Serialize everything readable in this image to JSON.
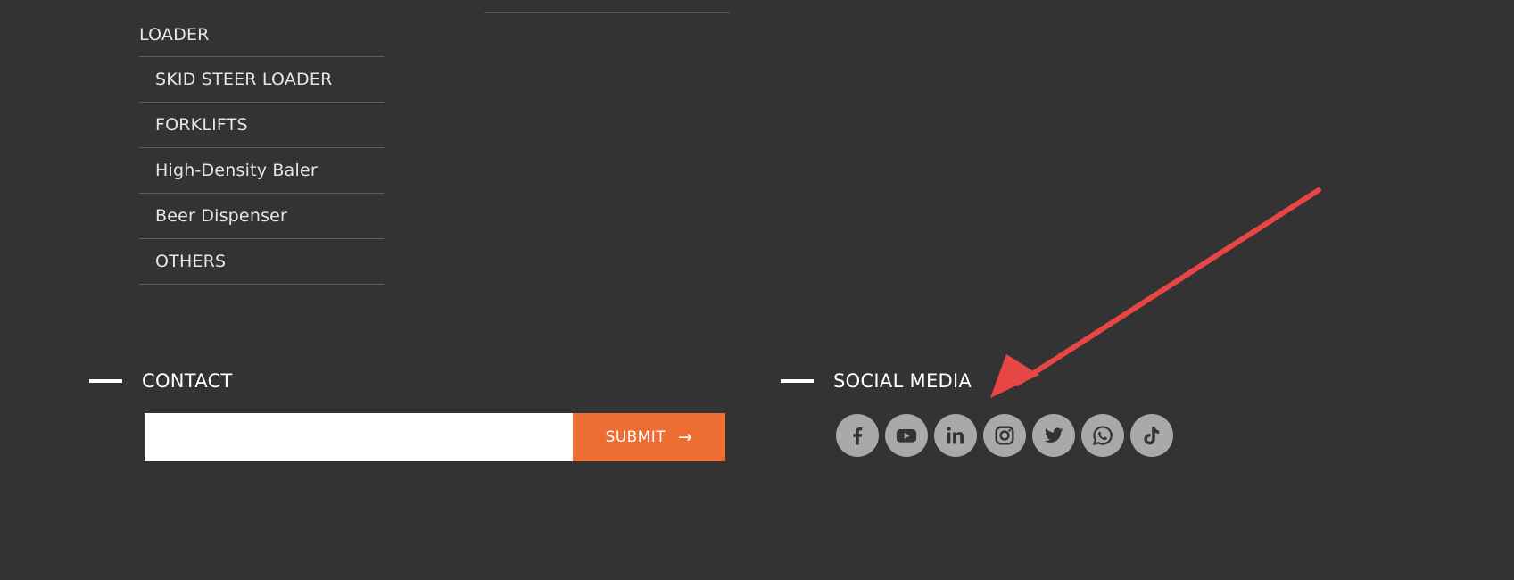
{
  "menu": {
    "parent": "LOADER",
    "items": [
      {
        "label": "SKID STEER LOADER"
      },
      {
        "label": "FORKLIFTS"
      },
      {
        "label": "High-Density Baler"
      },
      {
        "label": "Beer Dispenser"
      },
      {
        "label": "OTHERS"
      }
    ]
  },
  "contact": {
    "title": "CONTACT",
    "input_value": "",
    "submit_label": "SUBMIT",
    "submit_icon": "arrow-right-icon",
    "submit_color": "#ee6d33"
  },
  "social": {
    "title": "SOCIAL MEDIA",
    "icon_bg": "#a9a9a9",
    "icons": [
      "facebook-icon",
      "youtube-icon",
      "linkedin-icon",
      "instagram-icon",
      "twitter-icon",
      "whatsapp-icon",
      "tiktok-icon"
    ]
  },
  "annotation": {
    "color": "#e84545",
    "icon": "red-arrow-annotation"
  }
}
